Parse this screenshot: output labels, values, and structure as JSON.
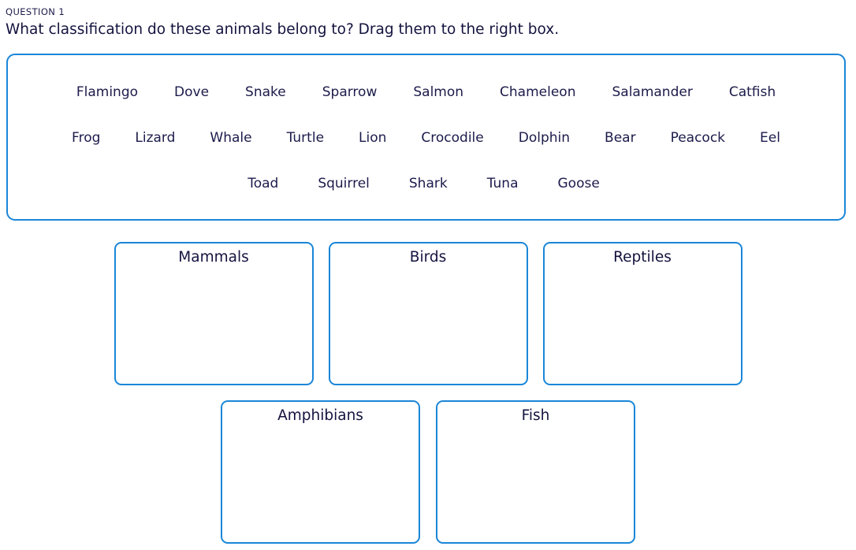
{
  "header": {
    "question_label": "QUESTION 1",
    "question_text": "What classification do these animals belong to? Drag them to the right box."
  },
  "colors": {
    "border_blue": "#1a86d8",
    "text_navy": "#1b1b4b",
    "title_navy": "#13133f",
    "background": "#ffffff"
  },
  "word_bank": {
    "rows": [
      [
        "Flamingo",
        "Dove",
        "Snake",
        "Sparrow",
        "Salmon",
        "Chameleon",
        "Salamander",
        "Catfish"
      ],
      [
        "Frog",
        "Lizard",
        "Whale",
        "Turtle",
        "Lion",
        "Crocodile",
        "Dolphin",
        "Bear",
        "Peacock",
        "Eel"
      ],
      [
        "Toad",
        "Squirrel",
        "Shark",
        "Tuna",
        "Goose"
      ]
    ]
  },
  "drop_zones": {
    "top_row": [
      {
        "title": "Mammals",
        "items": []
      },
      {
        "title": "Birds",
        "items": []
      },
      {
        "title": "Reptiles",
        "items": []
      }
    ],
    "bottom_row": [
      {
        "title": "Amphibians",
        "items": []
      },
      {
        "title": "Fish",
        "items": []
      }
    ]
  }
}
